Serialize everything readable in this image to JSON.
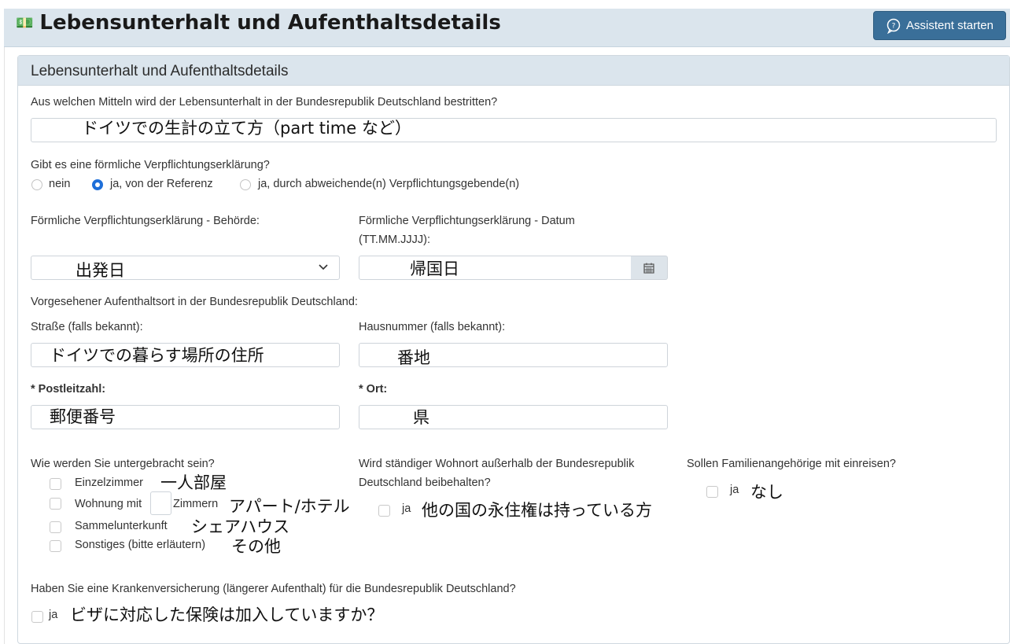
{
  "header": {
    "title": "Lebensunterhalt und Aufenthaltsdetails",
    "title_icon": "money-icon",
    "assistant_button": "Assistent starten"
  },
  "card": {
    "title": "Lebensunterhalt und Aufenthaltsdetails"
  },
  "livelihood": {
    "question": "Aus welchen Mitteln wird der Lebensunterhalt in der Bundesrepublik Deutschland bestritten?",
    "answer_note": "ドイツでの生計の立て方（part time など）"
  },
  "commitment": {
    "question": "Gibt es eine förmliche Verpflichtungserklärung?",
    "options": [
      {
        "label": "nein",
        "selected": false
      },
      {
        "label": "ja, von der Referenz",
        "selected": true
      },
      {
        "label": "ja, durch abweichende(n) Verpflichtungsgebende(n)",
        "selected": false
      }
    ],
    "authority_label": "Förmliche Verpflichtungserklärung - Behörde:",
    "authority_note": "出発日",
    "date_label_line1": "Förmliche Verpflichtungserklärung - Datum",
    "date_label_line2": "(TT.MM.JJJJ):",
    "date_note": "帰国日"
  },
  "residence": {
    "heading": "Vorgesehener Aufenthaltsort in der Bundesrepublik Deutschland:",
    "street_label": "Straße (falls bekannt):",
    "street_note": "ドイツでの暮らす場所の住所",
    "house_label": "Hausnummer (falls bekannt):",
    "house_note": "番地",
    "postal_label": "* Postleitzahl:",
    "postal_note": "郵便番号",
    "city_label": "* Ort:",
    "city_note": "県"
  },
  "accommodation": {
    "question": "Wie werden Sie untergebracht sein?",
    "single_room": "Einzelzimmer",
    "single_room_note": "一人部屋",
    "apartment_prefix": "Wohnung mit",
    "apartment_suffix": "Zimmern",
    "apartment_note": "アパート/ホテル",
    "shared": "Sammelunterkunft",
    "shared_note": "シェアハウス",
    "other": "Sonstiges (bitte erläutern)",
    "other_note": "その他"
  },
  "permanent_residence": {
    "question_line1": "Wird ständiger Wohnort außerhalb der Bundesrepublik",
    "question_line2": "Deutschland beibehalten?",
    "option": "ja",
    "note": "他の国の永住権は持っている方"
  },
  "family": {
    "question": "Sollen Familienangehörige mit einreisen?",
    "option": "ja",
    "note": "なし"
  },
  "insurance": {
    "question": "Haben Sie eine Krankenversicherung (längerer Aufenthalt) für die Bundesrepublik Deutschland?",
    "option": "ja",
    "note": "ビザに対応した保険は加入していますか？"
  },
  "colors": {
    "header_bg": "#dbe5ed",
    "button_bg": "#3a6f99",
    "radio_selected": "#1e6fd9"
  }
}
